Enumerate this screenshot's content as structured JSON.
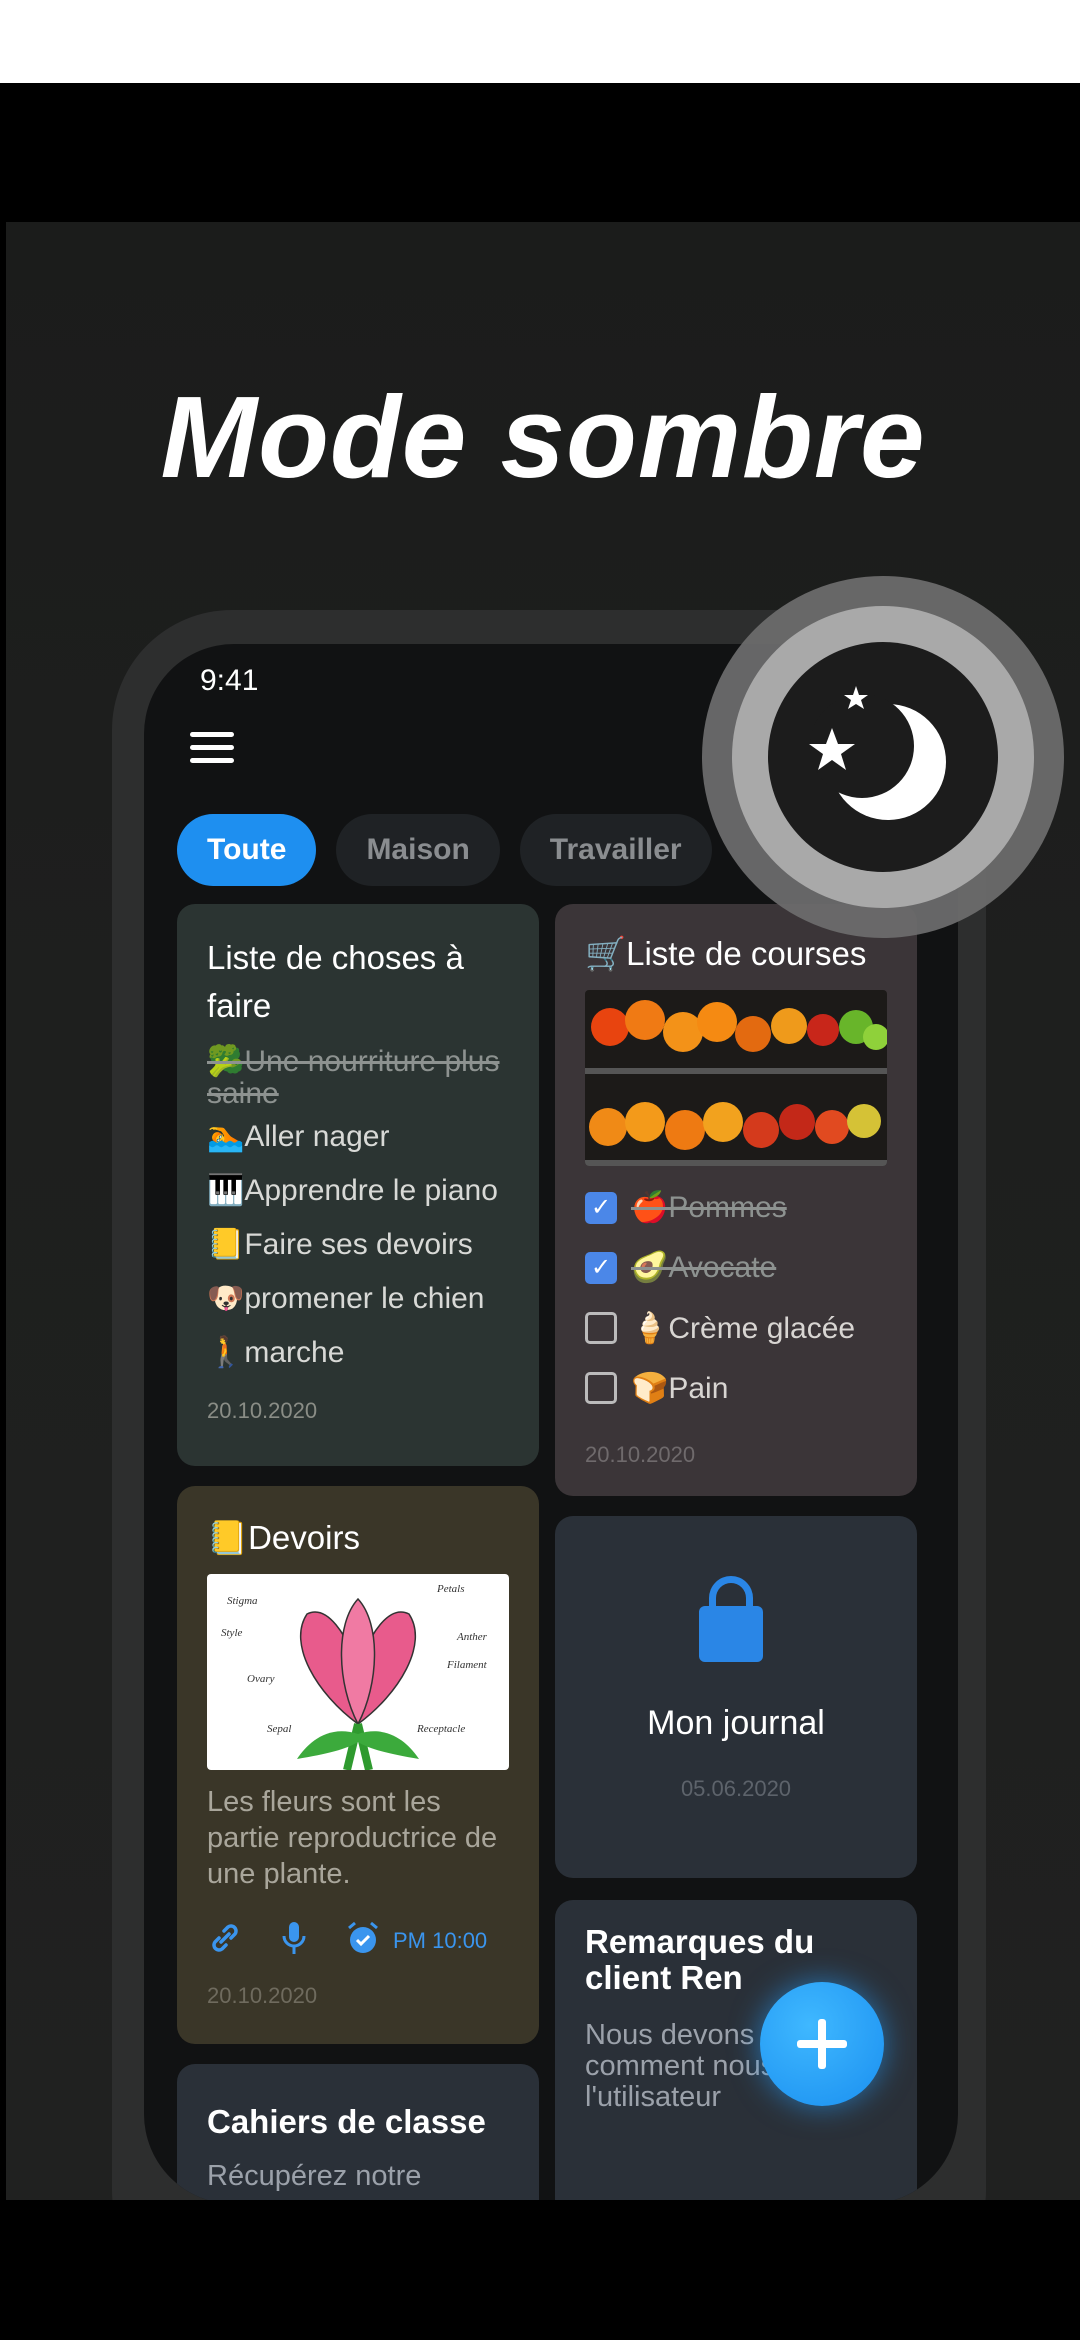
{
  "headline": "Mode sombre",
  "status": {
    "time": "9:41"
  },
  "tabs": [
    {
      "label": "Toute"
    },
    {
      "label": "Maison"
    },
    {
      "label": "Travailler"
    }
  ],
  "notes": {
    "todo": {
      "title": "Liste de choses à faire",
      "items": [
        "🥦Une nourriture plus saine",
        "🏊Aller nager",
        "🎹Apprendre le piano",
        "📒Faire ses devoirs",
        "🐶promener le chien",
        "🚶marche"
      ],
      "date": "20.10.2020"
    },
    "shopping": {
      "title": "🛒Liste de courses",
      "items": [
        {
          "label": "🍎Pommes",
          "checked": true
        },
        {
          "label": "🥑Avocate",
          "checked": true
        },
        {
          "label": "🍦Crème glacée",
          "checked": false
        },
        {
          "label": "🍞Pain",
          "checked": false
        }
      ],
      "date": "20.10.2020"
    },
    "homework": {
      "title": "📒Devoirs",
      "body": "Les fleurs sont les partie reproductrice de une plante.",
      "alarm": "PM 10:00",
      "date": "20.10.2020",
      "diagram_labels": [
        "Stigma",
        "Petals",
        "Style",
        "Anther",
        "Filament",
        "Ovary",
        "Sepal",
        "Receptacle"
      ]
    },
    "journal": {
      "title": "Mon journal",
      "date": "05.06.2020"
    },
    "client": {
      "title": "Remarques du client Ren",
      "body": "Nous devons repenser comment nous gérons l'utilisateur"
    },
    "notebooks": {
      "title": "Cahiers de classe",
      "body": "Récupérez notre"
    }
  },
  "icons": {
    "menu": "hamburger-icon",
    "fab": "plus-icon",
    "theme": "moon-stars-icon",
    "journal": "lock-icon"
  },
  "colors": {
    "accent": "#1e8ff0",
    "background": "#111213"
  }
}
